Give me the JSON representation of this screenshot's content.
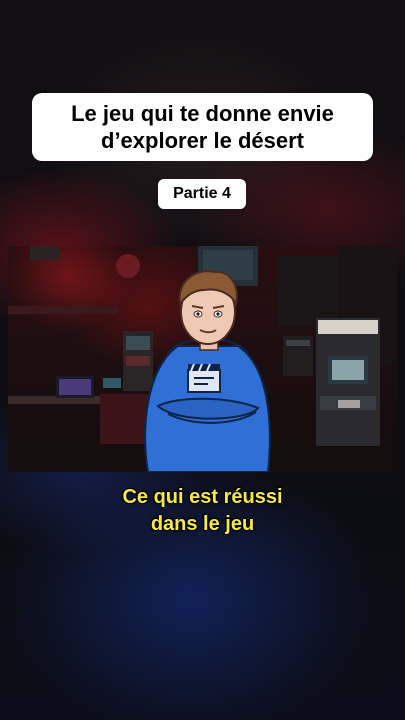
{
  "title": "Le jeu qui te donne envie d’explorer le désert",
  "part_label": "Partie 4",
  "subtitle": {
    "line1": "Ce qui est réussi",
    "line2": "dans le jeu"
  },
  "colors": {
    "subtitle": "#f5e94a",
    "hoodie": "#2f6fd6",
    "box": "#ffffff"
  },
  "icons": {
    "hoodie_logo": "clapperboard-icon"
  }
}
